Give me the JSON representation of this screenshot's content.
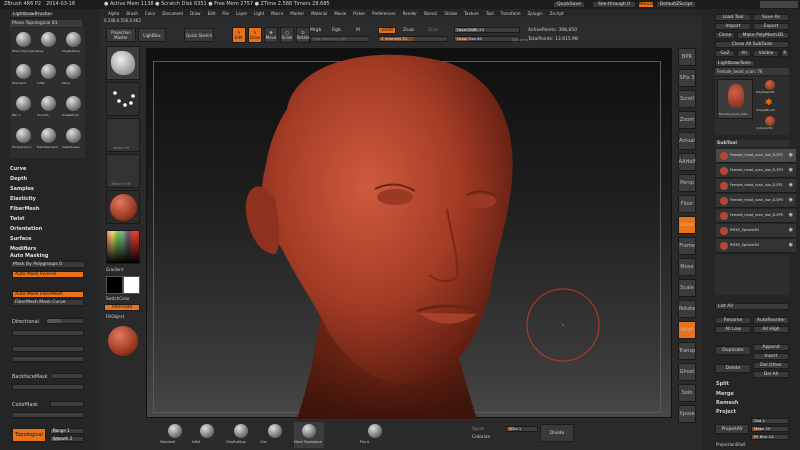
{
  "titlebar": {
    "app": "ZBrush 4R6 P2",
    "date": "2014-03-18",
    "stats": "● Active Mem 1138  ● Scratch Disk 6351  ● Free Mem 2757  ● ZTime 2.588  Timers 28.685",
    "quicksave": "QuickSave",
    "seethrough": "See-through 0",
    "menus": "Menus",
    "defaultscript": "DefaultZScript"
  },
  "menubar": [
    "Alpha",
    "Brush",
    "Color",
    "Document",
    "Draw",
    "Edit",
    "File",
    "Layer",
    "Light",
    "Macro",
    "Marker",
    "Material",
    "Movie",
    "Picker",
    "Preferences",
    "Render",
    "Stencil",
    "Stroke",
    "Texture",
    "Tool",
    "Transform",
    "Zplugin",
    "Zscript"
  ],
  "coords": "0.248,0.556,0.462",
  "left": {
    "panel_title": "Lightbox▸Brushes",
    "current_brush": "Move Topological 81",
    "brushes": [
      "Move Topological",
      "Clay",
      "ClayBuildup",
      "Standard",
      "Inflat",
      "Move",
      "Pen A",
      "Smooth",
      "SnakeHook",
      "TrimDynamic",
      "DamStandard",
      "SelectLasso"
    ],
    "sections": [
      "Curve",
      "Depth",
      "Samples",
      "Elasticity",
      "FiberMesh",
      "Twist",
      "Orientation",
      "Surface",
      "Modifiers"
    ],
    "automasking": "Auto Masking",
    "mask_polygroups": "Mask By Polygroups 0",
    "automask_inverse": "Auto Mask Inverse",
    "automask_fibermesh": "Auto Mask FiberMesh",
    "fibermesh_mask_curve": "FiberMesh Mask Curve",
    "directional": "Directional",
    "dir_falloff": "DirFalloff",
    "backface": "BackfaceMask",
    "colormask": "ColorMask",
    "topological": "Topological",
    "range": "Range 1",
    "smooth": "Smooth 2"
  },
  "col2": {
    "alpha_label": "Alpha Off",
    "texture_label": "Texture Off",
    "material_label": "MatCap Red",
    "gradient": "Gradient",
    "switchcolor": "SwitchColor",
    "alternate": "Alternate",
    "fillobject": "FillObject"
  },
  "toolbar": {
    "projection_master": "Projection Master",
    "lightbox": "LightBox",
    "quick_sketch": "Quick Sketch",
    "edit": "Edit",
    "draw": "Draw",
    "move": "Move",
    "scale": "Scale",
    "rotate": "Rotate",
    "mrgb": "Mrgb",
    "rgb": "Rgb",
    "m": "M",
    "zadd": "Zadd",
    "zsub": "Zsub",
    "zcut": "Zcut",
    "focal_shift": "Focal Shift -23",
    "draw_size": "Draw Size 84",
    "rgb_intensity": "Rgb Intensity 100",
    "z_intensity": "Z Intensity 51",
    "active_points": "ActivePoints: 398,850",
    "total_points": "TotalPoints: 13.615 Mil",
    "dynamic": "Dynamic"
  },
  "bottom": {
    "brushes": [
      "Standard",
      "Inflat",
      "ClayBuildup",
      "Clay",
      "Move Topological",
      "Pen A"
    ],
    "xpose": "Xpose",
    "colorize": "Colorize",
    "sdiv": "SDiv 1",
    "divide": "Divide"
  },
  "righticons": [
    "BPR",
    "SPix 3",
    "Scroll",
    "Zoom",
    "Actual",
    "AAHalf",
    "Persp",
    "Floor",
    "Local",
    "Frame",
    "Move",
    "Scale",
    "Rotate",
    "PolyF",
    "Transp",
    "Ghost",
    "Solo",
    "Xpose"
  ],
  "right": {
    "load_tool": "Load Tool",
    "save_as": "Save As",
    "import": "Import",
    "export": "Export",
    "clone": "Clone",
    "make_polymesh": "Make PolyMesh3D",
    "clone_all": "Clone All SubTools",
    "goz": "GoZ",
    "all": "All",
    "visible": "Visible",
    "r": "R",
    "lightbox_tools": "Lightbox▸Tools",
    "current_tool": "Female_head_scan: 76",
    "tool_thumbs": [
      "Female_head_scan...",
      "PolyMesh3D",
      "SimpleBrush",
      "Cylinder3D"
    ],
    "subtool_title": "SubTool",
    "subtools": [
      "Female_head_scan_low_D-EP2",
      "Female_head_scan_low_D-EP3",
      "Female_head_scan_low_D-EP1",
      "Female_head_scan_low_D-EP0",
      "Female_head_scan_low_D-EP0",
      "PM3D_Sphere3D",
      "PM3D_Sphere3D"
    ],
    "list_all": "List All",
    "rename": "Rename",
    "autoreorder": "AutoReorder",
    "all_low": "All Low",
    "all_high": "All High",
    "duplicate": "Duplicate",
    "append": "Append",
    "insert": "Insert",
    "delete": "Delete",
    "del_other": "Del Other",
    "del_all": "Del All",
    "split": "Split",
    "merge": "Merge",
    "remesh": "Remesh",
    "project": "Project",
    "dist": "Dist 1",
    "mean": "Mean 25",
    "projectall": "ProjectAll",
    "pa_blur": "PA Blur 10",
    "project_bas": "ProjectionShell"
  },
  "colors": {
    "accent": "#e8731c",
    "head": "#b5472f",
    "panel": "#262626"
  }
}
